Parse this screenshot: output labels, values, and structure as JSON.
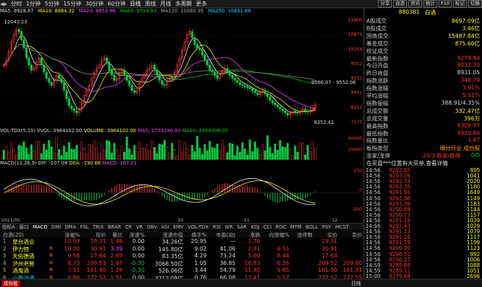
{
  "toolbar": {
    "periods": [
      "分时",
      "1分钟",
      "5分钟",
      "15分钟",
      "30分钟",
      "60分钟",
      "日线",
      "周线",
      "月线",
      "多周期",
      "更多"
    ],
    "active_period": "日线",
    "right_buttons": [
      "分享",
      "自选",
      "资讯",
      "统计",
      "F10",
      "标记",
      "切换"
    ]
  },
  "ma": {
    "label": "MA5: 8928.87",
    "ma10": "MA10: 8884.32",
    "ma20": "MA20: 8853.96",
    "ma60": "MA60: 9514.93",
    "ma120": "MA120: 10080.95",
    "ma250": "MA250: 10431.68"
  },
  "price_axis": [
    "11800",
    "10875",
    "10254",
    "9552",
    "9233",
    "8952",
    "8252",
    "7172"
  ],
  "price_annotations": {
    "high": "12043.23",
    "range": "9566.07 - 9552.06",
    "low": "8252.42"
  },
  "volume": {
    "label": "VOL-TDX(5,10) VVOL: 3964102.00",
    "volume": "VOLUME: 3964102.00",
    "ma5": "MA5: 2773190.00",
    "ma10": "MA10: 2454006.00",
    "axis": [
      "50000",
      "25000"
    ]
  },
  "macd": {
    "label": "MACD(12,26,9) DIF: -107.08",
    "dea": "DEA: -190.68",
    "macd": "MACD: 167.21",
    "axis": [
      "250",
      "0",
      "-250"
    ]
  },
  "date_axis": [
    "2021/05",
    "",
    "",
    "",
    "",
    "",
    "",
    "",
    "10",
    "",
    "",
    "11",
    "",
    "",
    "",
    "12"
  ],
  "indicator_tabs": [
    "指标A",
    "窗口",
    "MACD",
    "DMI",
    "DMA",
    "FSL",
    "TRIX",
    "BRAR",
    "CR",
    "VR",
    "OBV",
    "ASI",
    "EMV",
    "VOL-TDX",
    "RSI",
    "WR",
    "SAR",
    "KDJ",
    "CCI",
    "ROC",
    "MTM",
    "BOLL",
    "PSY",
    "MCST"
  ],
  "indicator_tab_active": "MACD",
  "table": {
    "headers": [
      "白酒(20)",
      "涨幅%",
      "现价",
      "量比",
      "涨速%",
      "流通市值",
      "换手%",
      "市盈(动)",
      "涨跌",
      "均涨幅%",
      "涨停数",
      "买价",
      "卖价"
    ],
    "rows": [
      {
        "idx": "1",
        "name": "皇台酒业",
        "flag": "",
        "chg": "10.03",
        "price": "19.31",
        "vr": "1.46",
        "speed": "0.00",
        "cap": "34.26亿",
        "turn": "20.95",
        "pe": "—",
        "diff": "1.76",
        "avg": "",
        "zt": "",
        "bid": "19.31",
        "ask": ""
      },
      {
        "idx": "2",
        "name": "伊力特",
        "flag": "R",
        "chg": "10.00",
        "price": "30.91",
        "vr": "3.39",
        "speed": "0.00",
        "cap": "145.80亿",
        "turn": "9.02",
        "pe": "41.06",
        "diff": "2.81",
        "avg": "6.55",
        "zt": "",
        "bid": "30.91",
        "ask": ""
      },
      {
        "idx": "3",
        "name": "天佑德酒",
        "flag": "R",
        "chg": "9.98",
        "price": "17.64",
        "vr": "2.89",
        "speed": "0.00",
        "cap": "83.35亿",
        "turn": "4.29",
        "pe": "73.24",
        "diff": "1.60",
        "avg": "8.44",
        "zt": "",
        "bid": "17.64",
        "ask": ""
      },
      {
        "idx": "4",
        "name": "泸州老窖",
        "flag": "R",
        "chg": "8.73",
        "price": "209.53",
        "vr": "1.97",
        "speed": "-0.30",
        "cap": "3068.50亿",
        "turn": "1.05",
        "pe": "36.85",
        "diff": "16.83",
        "avg": "6.26",
        "zt": "",
        "bid": "209.52",
        "ask": "209.80"
      },
      {
        "idx": "5",
        "name": "酒鬼酒",
        "flag": "R",
        "chg": "7.51",
        "price": "161.90",
        "vr": "1.29",
        "speed": "-0.30",
        "cap": "526.06亿",
        "turn": "3.44",
        "pe": "54.79",
        "diff": "11.40",
        "avg": "5.85",
        "zt": "",
        "bid": "161.90",
        "ask": "161.91"
      },
      {
        "idx": "6",
        "name": "山西汾酒",
        "flag": "R",
        "chg": "6.86",
        "price": "272.52",
        "vr": "1.51",
        "speed": "0.00",
        "cap": "3312.08亿",
        "turn": "0.76",
        "pe": "66.08",
        "diff": "17.41",
        "avg": "5.17",
        "zt": "",
        "bid": "272.52",
        "ask": "272.55"
      }
    ]
  },
  "bottom": {
    "left_button": "成份股",
    "right_tab": "日线"
  },
  "right_panel": {
    "code": "880381",
    "name": "白酒",
    "stats": [
      {
        "k": "A股成交",
        "v": "8697.09亿",
        "c": "yel"
      },
      {
        "k": "B股成交",
        "v": "3.46亿",
        "c": "yel"
      },
      {
        "k": "国债成交",
        "v": "15487.84亿",
        "c": "yel"
      },
      {
        "k": "基金成交",
        "v": "875.60亿",
        "c": "yel"
      },
      {
        "k": "权证成交",
        "v": "",
        "c": "yel"
      },
      {
        "k": "最新指数",
        "v": "9279.84",
        "c": "red"
      },
      {
        "k": "今日开盘",
        "v": "9032.30",
        "c": "red"
      },
      {
        "k": "昨日收盘",
        "v": "8931.05",
        "c": "wht"
      },
      {
        "k": "指数涨跌",
        "v": "348.79",
        "c": "red"
      },
      {
        "k": "指数涨幅",
        "v": "3.91%",
        "c": "red"
      },
      {
        "k": "平均涨幅",
        "v": "5.51%",
        "c": "red"
      },
      {
        "k": "指数振幅",
        "v": "388.91/4.35%",
        "c": "wht"
      },
      {
        "k": "总成交额",
        "v": "332.47亿",
        "c": "yel"
      },
      {
        "k": "总成交量",
        "v": "396万",
        "c": "yel"
      },
      {
        "k": "最高指数",
        "v": "9309.77",
        "c": "red"
      },
      {
        "k": "最低指数",
        "v": "8920.86",
        "c": "red"
      },
      {
        "k": "指数量比",
        "v": "1.67",
        "c": "red"
      },
      {
        "k": "板指类型",
        "v": "细分行业 成份股",
        "c": "org"
      }
    ],
    "rise_fall": {
      "label": "涨家/涨停",
      "value": "20/3 跌家/跌停",
      "tail": "0/0"
    },
    "hint": "在买盘***位置有大买单,查看详情",
    "ticks": [
      {
        "t": "14:56",
        "p": "9292.65",
        "v": "895"
      },
      {
        "t": "14:56",
        "p": "9293.26",
        "v": "1041"
      },
      {
        "t": "14:56",
        "p": "9292.74",
        "v": "2020"
      },
      {
        "t": "14:56",
        "p": "9292.35",
        "v": "1180"
      },
      {
        "t": "14:56",
        "p": "9291.91",
        "v": "1649"
      },
      {
        "t": "14:56",
        "p": "9292.06",
        "v": "1149"
      },
      {
        "t": "14:56",
        "p": "9291.39",
        "v": "1183"
      },
      {
        "t": "14:56",
        "p": "9290.88",
        "v": "1144"
      },
      {
        "t": "14:56",
        "p": "9290.73",
        "v": "1157"
      },
      {
        "t": "14:56",
        "p": "9291.18",
        "v": "1039"
      },
      {
        "t": "14:56",
        "p": "9291.43",
        "v": "1029"
      },
      {
        "t": "14:56",
        "p": "9291.23",
        "v": "1079"
      },
      {
        "t": "14:56",
        "p": "9291.28",
        "v": "1117"
      },
      {
        "t": "14:56",
        "p": "9291.19",
        "v": "1199"
      },
      {
        "t": "14:56",
        "p": "9290.99",
        "v": "1123"
      },
      {
        "t": "14:56",
        "p": "9290.52",
        "v": "892"
      },
      {
        "t": "14:56",
        "p": "9290.23",
        "v": "1006"
      },
      {
        "t": "14:59",
        "p": "9289.88",
        "v": "1088"
      },
      {
        "t": "14:59",
        "p": "9289.12",
        "v": "1051"
      },
      {
        "t": "15:00",
        "p": "9279.84",
        "v": "2696"
      }
    ]
  },
  "colors": {
    "up": "#ff3333",
    "down": "#00cc44",
    "ma5": "#ffffff",
    "ma10": "#ffff00",
    "ma20": "#ff44ff",
    "ma60": "#00cc00",
    "ma120": "#888888"
  }
}
